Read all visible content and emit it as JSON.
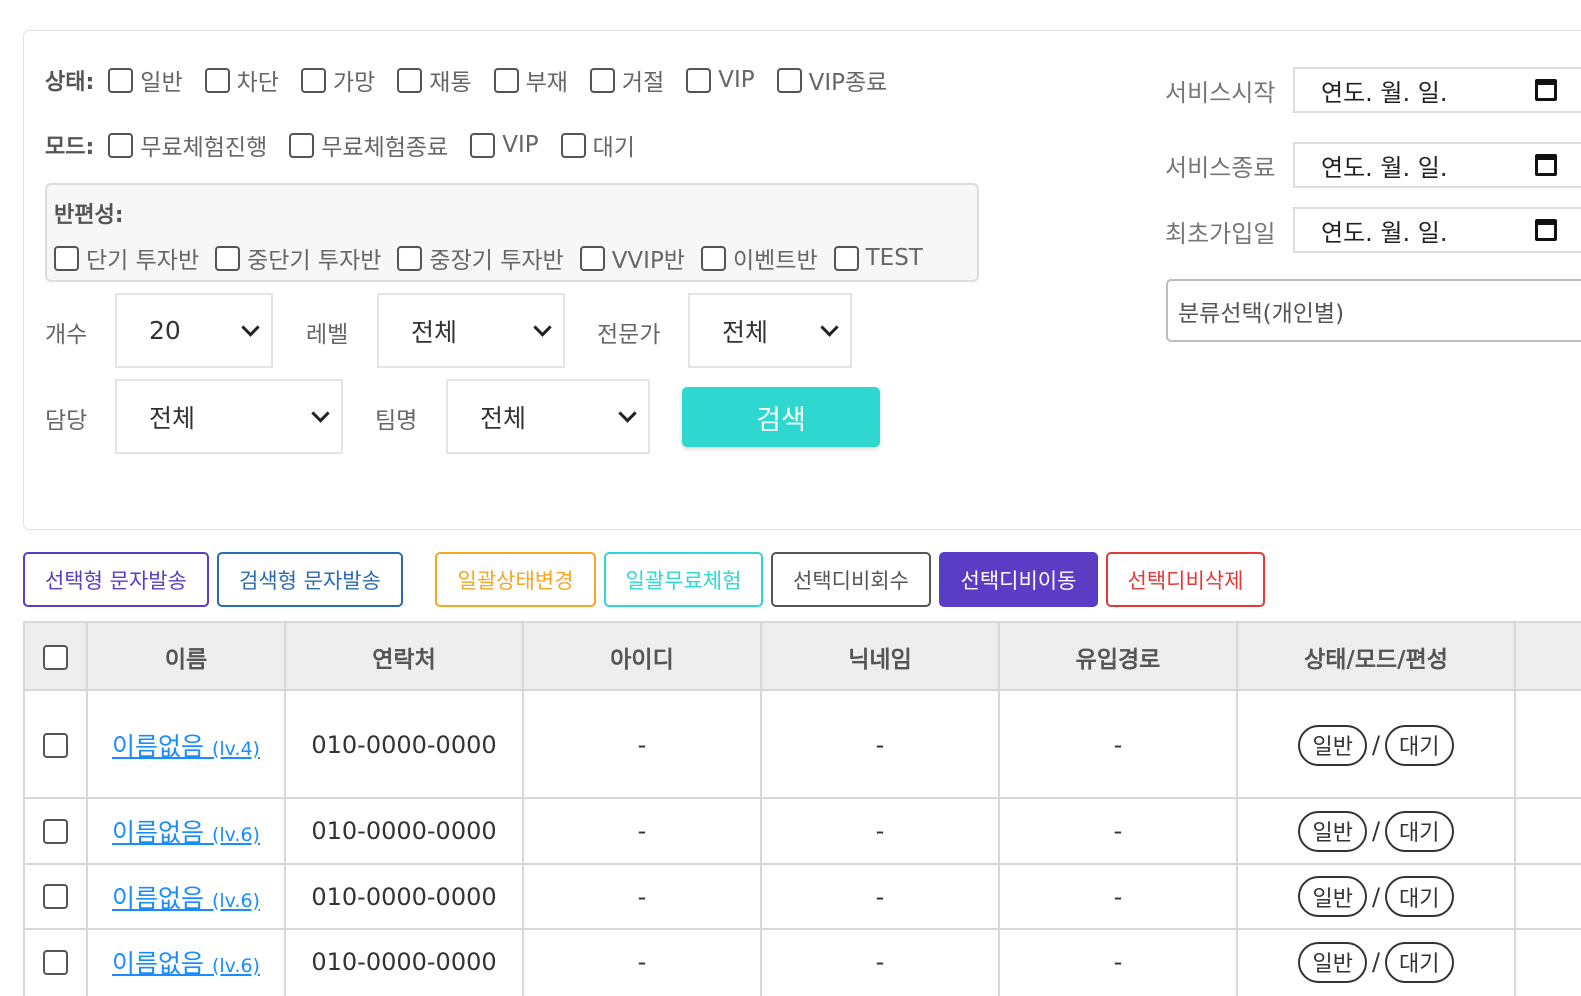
{
  "filters": {
    "status": {
      "label": "상태:",
      "options": [
        "일반",
        "차단",
        "가망",
        "재통",
        "부재",
        "거절",
        "VIP",
        "VIP종료"
      ]
    },
    "mode": {
      "label": "모드:",
      "options": [
        "무료체험진행",
        "무료체험종료",
        "VIP",
        "대기"
      ]
    },
    "class": {
      "label": "반편성:",
      "options": [
        "단기 투자반",
        "중단기 투자반",
        "중장기 투자반",
        "VVIP반",
        "이벤트반",
        "TEST"
      ]
    },
    "count": {
      "label": "개수",
      "value": "20"
    },
    "level": {
      "label": "레벨",
      "value": "전체"
    },
    "expert": {
      "label": "전문가",
      "value": "전체"
    },
    "manager": {
      "label": "담당",
      "value": "전체"
    },
    "team": {
      "label": "팀명",
      "value": "전체"
    },
    "search_label": "검색",
    "service_start": {
      "label": "서비스시작",
      "value": "연도. 월. 일."
    },
    "service_end": {
      "label": "서비스종료",
      "value": "연도. 월. 일."
    },
    "first_join": {
      "label": "최초가입일",
      "value": "연도. 월. 일."
    },
    "classify_placeholder": "분류선택(개인별)"
  },
  "actions": [
    {
      "label": "선택형 문자발송",
      "color": "#5b3cc4"
    },
    {
      "label": "검색형 문자발송",
      "color": "#2a6bb5"
    },
    {
      "label": "일괄상태변경",
      "color": "#f5a623"
    },
    {
      "label": "일괄무료체험",
      "color": "#2ed8d1"
    },
    {
      "label": "선택디비회수",
      "color": "#555555"
    },
    {
      "label": "선택디비이동",
      "color": "#5b3cc4"
    },
    {
      "label": "선택디비삭제",
      "color": "#e53935"
    }
  ],
  "table": {
    "headers": [
      "이름",
      "연락처",
      "아이디",
      "닉네임",
      "유입경로",
      "상태/모드/편성"
    ],
    "rows": [
      {
        "name": "이름없음",
        "level": "(lv.4)",
        "phone": "010-0000-0000",
        "id": "-",
        "nickname": "-",
        "source": "-",
        "status": "일반",
        "mode": "대기"
      },
      {
        "name": "이름없음",
        "level": "(lv.6)",
        "phone": "010-0000-0000",
        "id": "-",
        "nickname": "-",
        "source": "-",
        "status": "일반",
        "mode": "대기"
      },
      {
        "name": "이름없음",
        "level": "(lv.6)",
        "phone": "010-0000-0000",
        "id": "-",
        "nickname": "-",
        "source": "-",
        "status": "일반",
        "mode": "대기"
      },
      {
        "name": "이름없음",
        "level": "(lv.6)",
        "phone": "010-0000-0000",
        "id": "-",
        "nickname": "-",
        "source": "-",
        "status": "일반",
        "mode": "대기"
      }
    ]
  }
}
